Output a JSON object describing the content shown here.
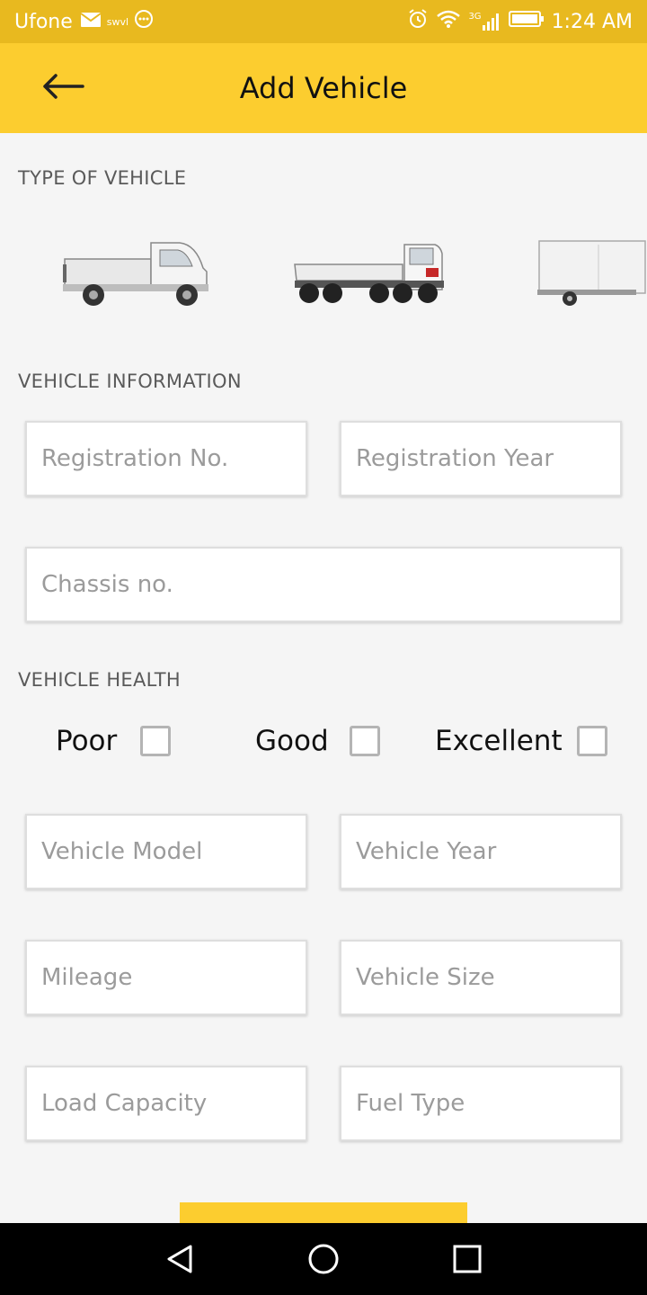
{
  "status_bar": {
    "carrier": "Ufone",
    "small_text": "swvl",
    "network": "3G",
    "time": "1:24 AM"
  },
  "app_bar": {
    "title": "Add Vehicle",
    "back_icon": "arrow-left-icon"
  },
  "sections": {
    "type_of_vehicle": "TYPE OF VEHICLE",
    "vehicle_information": "VEHICLE INFORMATION",
    "vehicle_health": "VEHICLE HEALTH"
  },
  "vehicle_types": [
    {
      "icon": "pickup-truck-icon"
    },
    {
      "icon": "flatbed-truck-icon"
    },
    {
      "icon": "trailer-icon"
    }
  ],
  "fields": {
    "registration_no": {
      "placeholder": "Registration No.",
      "value": ""
    },
    "registration_year": {
      "placeholder": "Registration Year",
      "value": ""
    },
    "chassis_no": {
      "placeholder": "Chassis no.",
      "value": ""
    },
    "vehicle_model": {
      "placeholder": "Vehicle Model",
      "value": ""
    },
    "vehicle_year": {
      "placeholder": "Vehicle Year",
      "value": ""
    },
    "mileage": {
      "placeholder": "Mileage",
      "value": ""
    },
    "vehicle_size": {
      "placeholder": "Vehicle Size",
      "value": ""
    },
    "load_capacity": {
      "placeholder": "Load Capacity",
      "value": ""
    },
    "fuel_type": {
      "placeholder": "Fuel Type",
      "value": ""
    }
  },
  "health_options": [
    {
      "label": "Poor",
      "checked": false
    },
    {
      "label": "Good",
      "checked": false
    },
    {
      "label": "Excellent",
      "checked": false
    }
  ],
  "colors": {
    "status_bar": "#e8b91f",
    "app_bar": "#fccd2f",
    "background": "#f5f5f5"
  }
}
